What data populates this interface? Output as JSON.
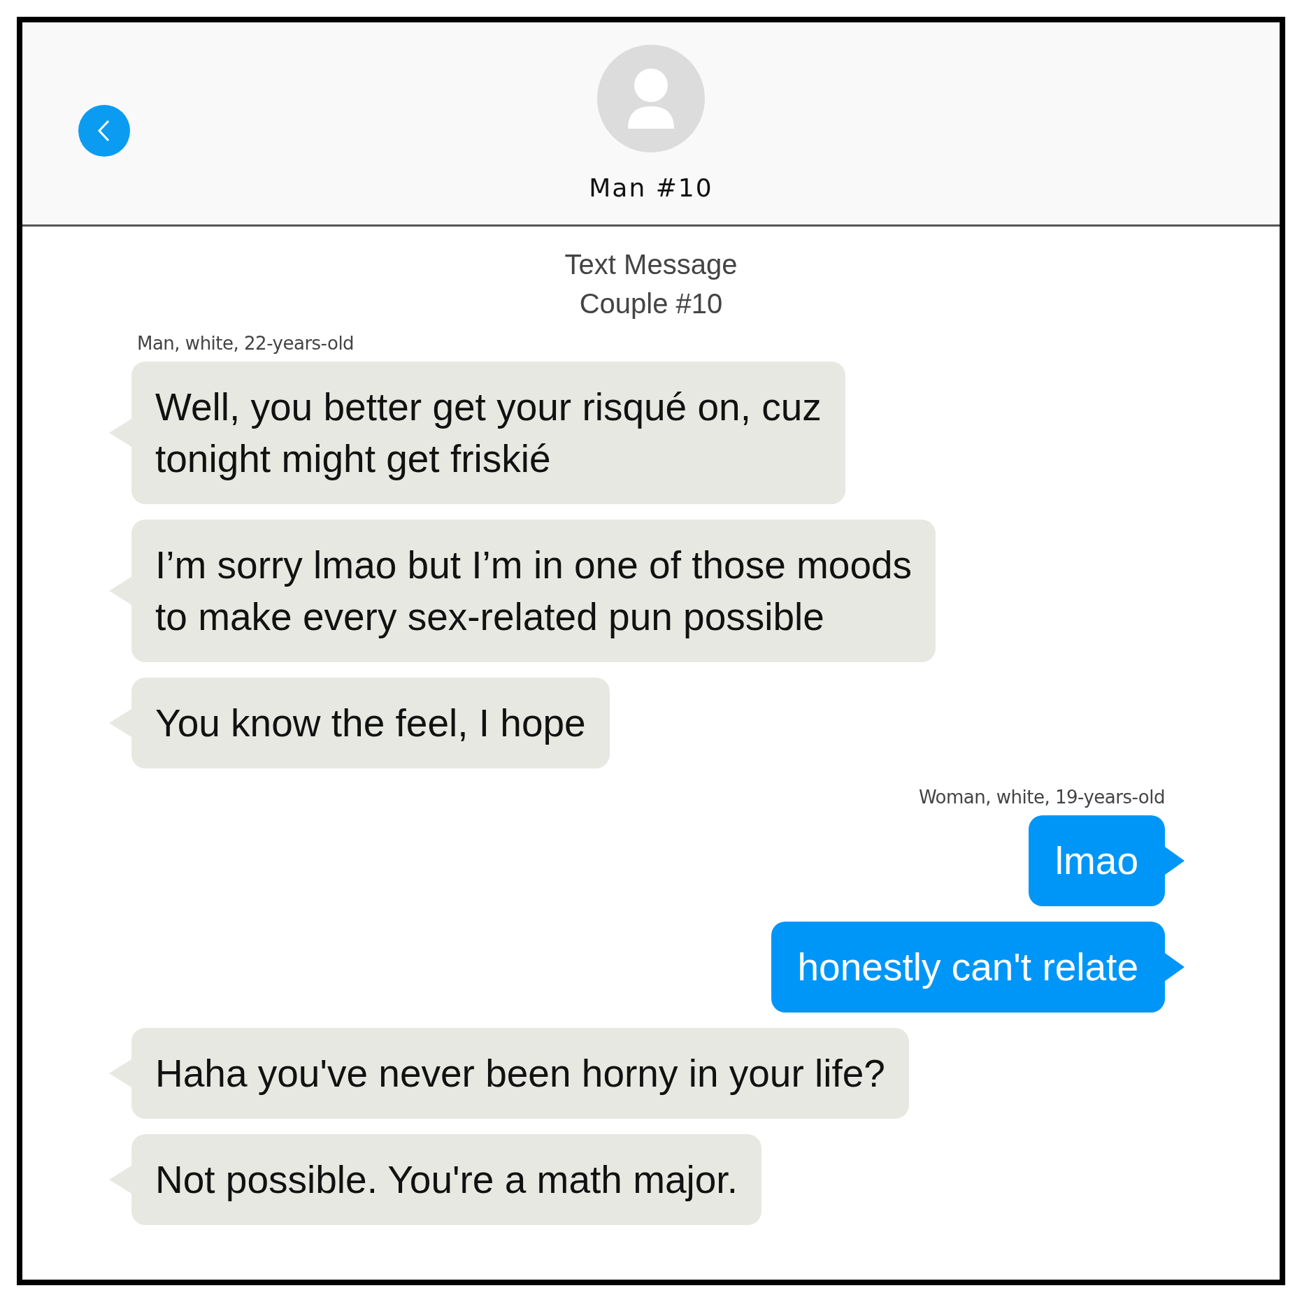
{
  "header": {
    "contact_name": "Man #10"
  },
  "thread_title": [
    "Text Message",
    "Couple #10"
  ],
  "messages": [
    {
      "kind": "received_label",
      "text": "Man, white, 22-years-old"
    },
    {
      "kind": "received",
      "text": "Well, you better get your risqué on, cuz\ntonight might get friskié"
    },
    {
      "kind": "received",
      "text": "I’m sorry lmao but I’m in one of those moods\nto make every sex-related pun possible"
    },
    {
      "kind": "received",
      "text": "You know the feel, I hope"
    },
    {
      "kind": "sent_label",
      "text": "Woman, white, 19-years-old"
    },
    {
      "kind": "sent",
      "text": "lmao"
    },
    {
      "kind": "sent",
      "text": "honestly can't relate"
    },
    {
      "kind": "received",
      "text": "Haha you've never been horny in your life?"
    },
    {
      "kind": "received",
      "text": "Not possible. You're a math major."
    }
  ]
}
